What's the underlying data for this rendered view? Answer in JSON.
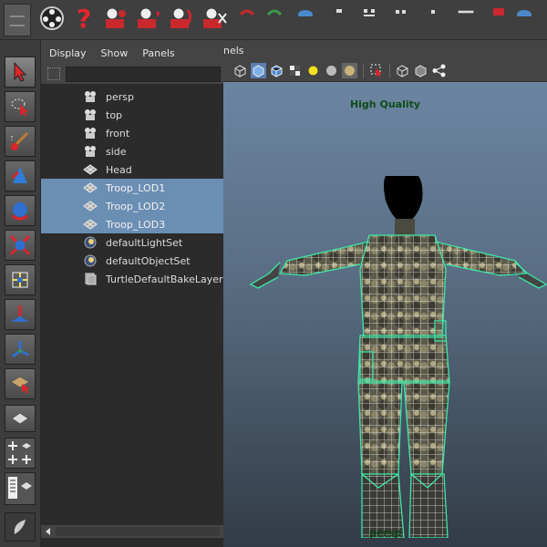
{
  "outliner": {
    "menu": [
      "Display",
      "Show",
      "Panels"
    ],
    "items": [
      {
        "label": "persp",
        "icon": "camera-icon",
        "selected": false
      },
      {
        "label": "top",
        "icon": "camera-icon",
        "selected": false
      },
      {
        "label": "front",
        "icon": "camera-icon",
        "selected": false
      },
      {
        "label": "side",
        "icon": "camera-icon",
        "selected": false
      },
      {
        "label": "Head",
        "icon": "mesh-icon",
        "selected": false
      },
      {
        "label": "Troop_LOD1",
        "icon": "mesh-icon",
        "selected": true
      },
      {
        "label": "Troop_LOD2",
        "icon": "mesh-icon",
        "selected": true
      },
      {
        "label": "Troop_LOD3",
        "icon": "mesh-icon",
        "selected": true
      },
      {
        "label": "defaultLightSet",
        "icon": "set-icon",
        "selected": false
      },
      {
        "label": "defaultObjectSet",
        "icon": "set-icon",
        "selected": false
      },
      {
        "label": "TurtleDefaultBakeLayer",
        "icon": "bake-layer-icon",
        "selected": false
      }
    ]
  },
  "viewport": {
    "menu_partial": "nels",
    "quality_label": "High Quality",
    "camera_label": "persp"
  },
  "colors": {
    "selection": "#6b8eb3",
    "wireframe_selected": "#3ee6a8",
    "viewport_top": "#6f8aa8",
    "viewport_bottom": "#323c46"
  }
}
